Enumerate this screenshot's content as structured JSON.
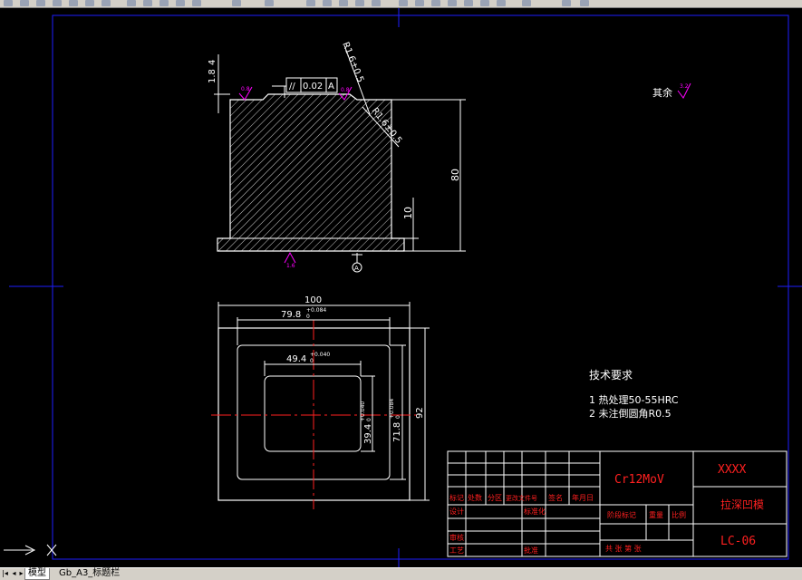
{
  "drawing": {
    "tolerance_frame": {
      "symbol": "//",
      "value": "0.02",
      "datum": "A"
    },
    "chamfer_top": "R1.6±0.5",
    "chamfer_side": "R1.6±0.5",
    "dim_left_small": "1.8",
    "dim_left_small_b": "4",
    "rough_left": "0.8",
    "rough_mid": "0.8",
    "rough_bottom": "1.6",
    "datum_label": "A",
    "dim_height_total": "80",
    "dim_height_base": "10",
    "rough_other_label": "其余",
    "rough_other_value": "3.2",
    "dim_width_outer": "100",
    "dim_width_pocket": "79.8",
    "dim_width_pocket_tol": "+0.084",
    "dim_width_pocket_tol_low": "0",
    "dim_width_inner": "49.4",
    "dim_width_inner_tol": "+0.040",
    "dim_width_inner_tol_low": "0",
    "dim_height_outer": "92",
    "dim_height_pocket": "71.8",
    "dim_height_pocket_tol": "+0.084",
    "dim_height_pocket_tol_low": "0",
    "dim_height_inner": "39.4",
    "dim_height_inner_tol": "+0.040",
    "dim_height_inner_tol_low": "0"
  },
  "notes": {
    "heading": "技术要求",
    "line1": "1  热处理50-55HRC",
    "line2": "2  未注倒圆角R0.5"
  },
  "title_block": {
    "material": "Cr12MoV",
    "company": "XXXX",
    "part_name": "拉深凹模",
    "drawing_no": "LC-06",
    "row_headers": [
      "标记",
      "处数",
      "分区",
      "更改文件号",
      "签名",
      "年月日"
    ],
    "design": "设计",
    "standardize": "标准化",
    "review": "审核",
    "process": "工艺",
    "approve": "批准",
    "stage_mark": "阶段标记",
    "weight": "重量",
    "scale": "比例",
    "sheet_info": "共   张 第   张"
  },
  "tabs": [
    {
      "label": "模型"
    },
    {
      "label": "Gb_A3_标题栏"
    }
  ],
  "colors": {
    "background": "#000000",
    "lines": "#ffffff",
    "border": "#1e1eff",
    "centerline": "#ff2020",
    "dim_text": "#ffffff",
    "roughness": "#ff00ff",
    "title_red": "#ff2020"
  }
}
